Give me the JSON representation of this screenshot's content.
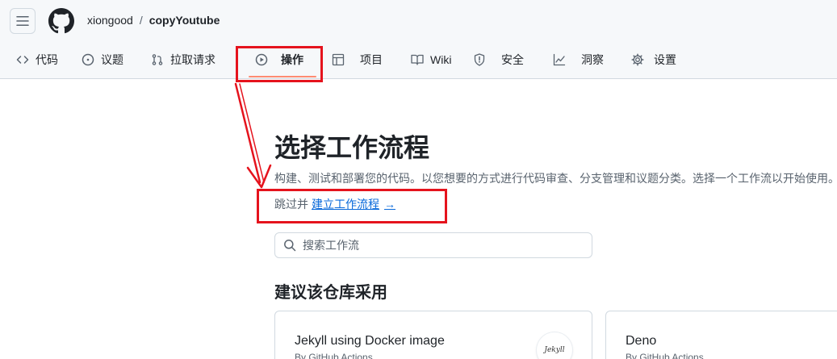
{
  "header": {
    "owner": "xiongood",
    "separator": "/",
    "repo": "copyYoutube"
  },
  "tabs": [
    {
      "label": "代码",
      "icon": "code-icon"
    },
    {
      "label": "议题",
      "icon": "issue-icon"
    },
    {
      "label": "拉取请求",
      "icon": "pull-request-icon"
    },
    {
      "label": "操作",
      "icon": "play-icon",
      "active": true
    },
    {
      "label": "项目",
      "icon": "table-icon"
    },
    {
      "label": "Wiki",
      "icon": "book-icon"
    },
    {
      "label": "安全",
      "icon": "shield-icon"
    },
    {
      "label": "洞察",
      "icon": "graph-icon"
    },
    {
      "label": "设置",
      "icon": "gear-icon"
    }
  ],
  "main": {
    "title": "选择工作流程",
    "description": "构建、测试和部署您的代码。以您想要的方式进行代码审查、分支管理和议题分类。选择一个工作流以开始使用。",
    "skip_prefix": "跳过并",
    "skip_link": "建立工作流程",
    "skip_arrow": "→",
    "search_placeholder": "搜索工作流",
    "section_title": "建议该仓库采用"
  },
  "cards": [
    {
      "name": "Jekyll using Docker image",
      "by": "By GitHub Actions",
      "logo_text": "Jekyll"
    },
    {
      "name": "Deno",
      "by": "By GitHub Actions"
    }
  ],
  "colors": {
    "annotation": "#e5131d",
    "link": "#0969da",
    "active_tab_underline": "#fd8c73"
  }
}
